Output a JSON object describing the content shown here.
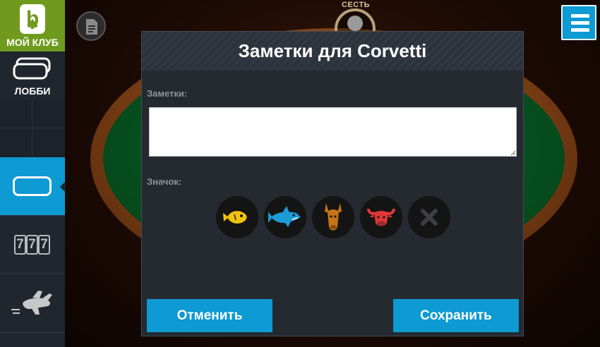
{
  "sidebar": {
    "club_label": "МОЙ КЛУБ",
    "lobby_label": "ЛОББИ",
    "slots_digits": [
      "7",
      "7",
      "7"
    ],
    "accent_color": "#0e9ad2",
    "club_color": "#6f9a1d"
  },
  "table": {
    "seat_label": "СЕСТЬ"
  },
  "modal": {
    "title": "Заметки для Corvetti",
    "notes_label": "Заметки:",
    "notes_value": "",
    "icon_label": "Значок:",
    "icons": [
      "fish-icon",
      "shark-icon",
      "donkey-icon",
      "bull-icon",
      "clear-icon"
    ],
    "cancel_label": "Отменить",
    "save_label": "Сохранить"
  }
}
